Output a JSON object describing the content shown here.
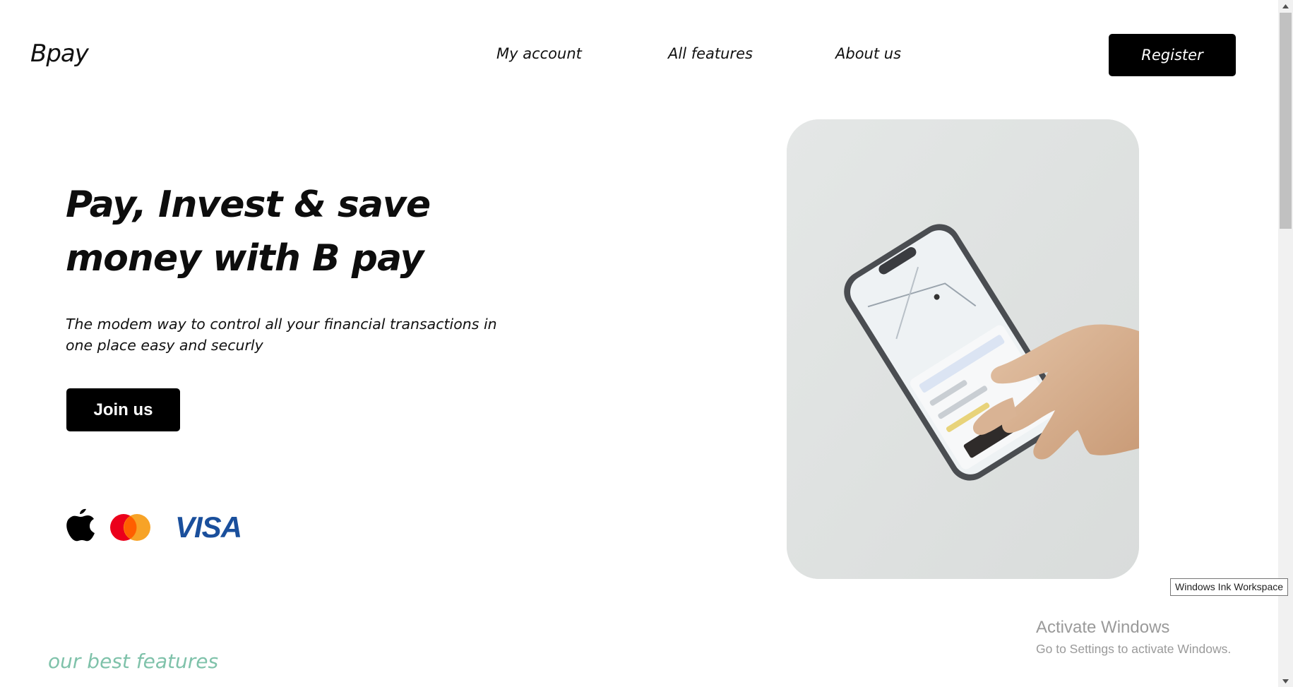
{
  "header": {
    "brand": "Bpay",
    "nav": [
      {
        "label": "My account"
      },
      {
        "label": "All features"
      },
      {
        "label": "About us"
      }
    ],
    "register_label": "Register"
  },
  "hero": {
    "headline_line1": "Pay, Invest & save",
    "headline_line2": "money with B pay",
    "subtext_line1": "The modem way to control all your financial transactions in",
    "subtext_line2": "one place easy and securly",
    "join_label": "Join us",
    "payment_logos": [
      "apple-icon",
      "mastercard-icon",
      "visa-icon"
    ],
    "visa_text": "VISA"
  },
  "features": {
    "title": "our best features"
  },
  "overlay": {
    "tooltip": "Windows Ink Workspace",
    "activate_title": "Activate Windows",
    "activate_sub": "Go to Settings to activate Windows."
  },
  "colors": {
    "accent_green": "#7fc2aa",
    "button_bg": "#000000",
    "visa_blue": "#1a4f9c",
    "mastercard_red": "#eb001b",
    "mastercard_orange": "#f79e1b"
  }
}
